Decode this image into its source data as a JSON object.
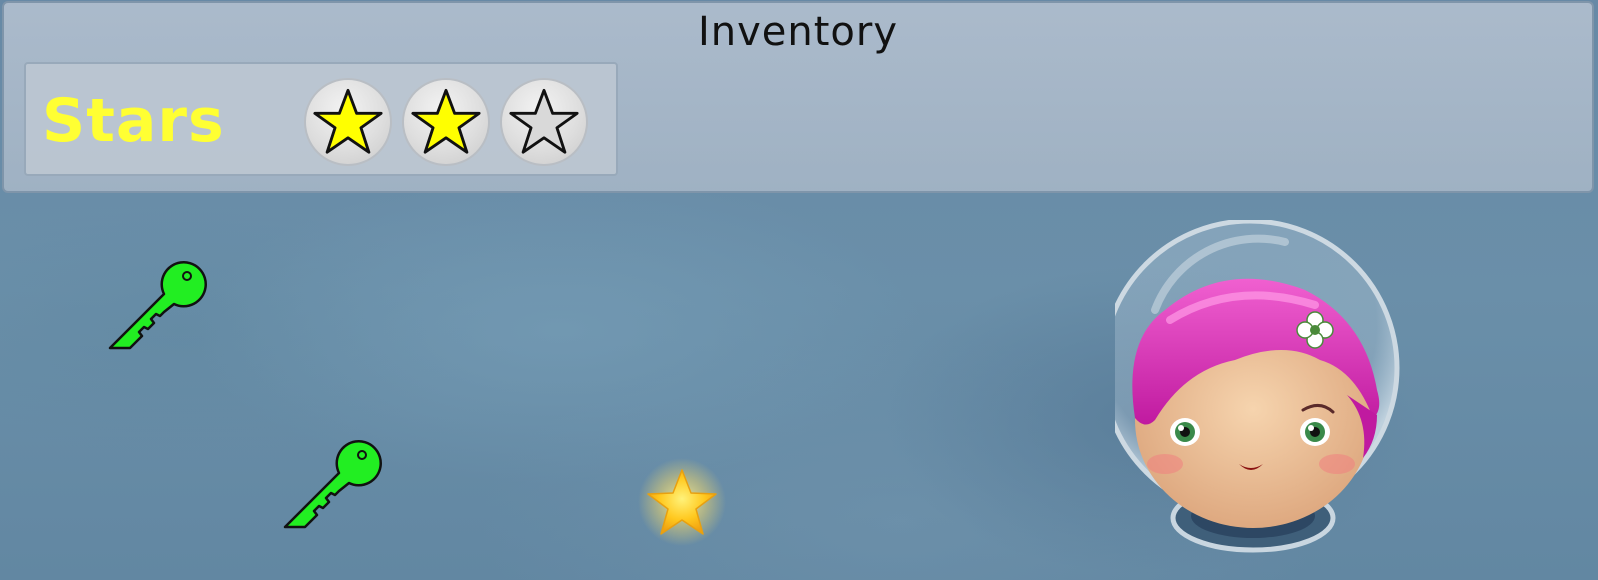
{
  "inventory": {
    "title": "Inventory",
    "stars": {
      "label": "Stars",
      "label_color": "#ffff33",
      "collected": 2,
      "total": 3,
      "slots": [
        {
          "state": "collected",
          "icon": "star-filled-icon",
          "color": "#ffff00"
        },
        {
          "state": "collected",
          "icon": "star-filled-icon",
          "color": "#ffff00"
        },
        {
          "state": "empty",
          "icon": "star-outline-icon",
          "color": "#d9d9d9"
        }
      ]
    }
  },
  "world": {
    "keys": [
      {
        "icon": "key-icon",
        "color": "#22ee22"
      },
      {
        "icon": "key-icon",
        "color": "#22ee22"
      }
    ],
    "pickups": [
      {
        "icon": "glowing-star-icon",
        "color": "#ffcc22"
      }
    ],
    "player": {
      "icon": "astronaut-girl-icon",
      "hair_color": "#e020b8"
    }
  }
}
